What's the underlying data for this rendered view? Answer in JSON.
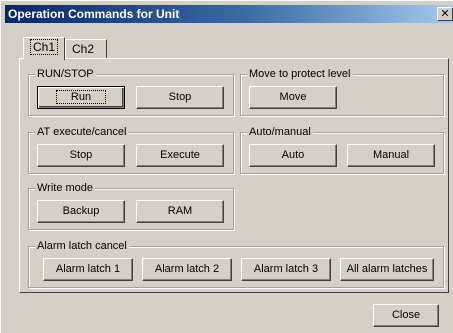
{
  "window": {
    "title": "Operation Commands for Unit",
    "close_glyph": "✕"
  },
  "tabs": [
    {
      "label": "Ch1",
      "active": true
    },
    {
      "label": "Ch2",
      "active": false
    }
  ],
  "groups": {
    "run_stop": {
      "title": "RUN/STOP",
      "buttons": [
        "Run",
        "Stop"
      ]
    },
    "protect": {
      "title": "Move to protect level",
      "buttons": [
        "Move"
      ]
    },
    "at": {
      "title": "AT execute/cancel",
      "buttons": [
        "Stop",
        "Execute"
      ]
    },
    "auto_manual": {
      "title": "Auto/manual",
      "buttons": [
        "Auto",
        "Manual"
      ]
    },
    "write_mode": {
      "title": "Write mode",
      "buttons": [
        "Backup",
        "RAM"
      ]
    },
    "alarm": {
      "title": "Alarm latch cancel",
      "buttons": [
        "Alarm latch 1",
        "Alarm latch 2",
        "Alarm latch 3",
        "All alarm latches"
      ]
    }
  },
  "footer": {
    "close_label": "Close"
  }
}
